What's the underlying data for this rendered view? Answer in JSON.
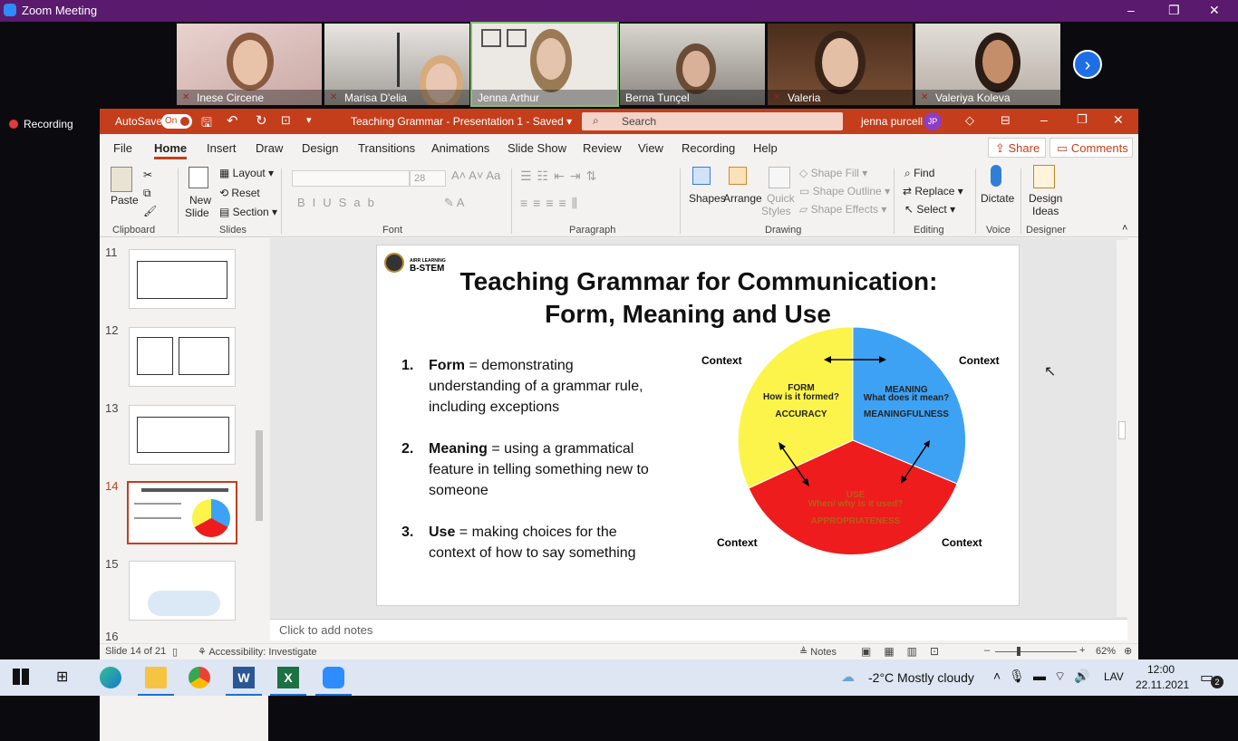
{
  "zoom": {
    "title": "Zoom Meeting",
    "recording_label": "Recording",
    "participants": [
      "Inese Circene",
      "Marisa D'elia",
      "Jenna Arthur",
      "Berna Tunçel",
      "Valeria",
      "Valeriya Koleva"
    ],
    "next_arrow": "›",
    "win_controls": {
      "minimize": "–",
      "restore": "❐",
      "close": "✕"
    }
  },
  "pp": {
    "autosave_label": "AutoSave",
    "autosave_state": "On",
    "doc_title": "Teaching Grammar - Presentation 1  -  Saved  ▾",
    "search_placeholder": "Search",
    "user": "jenna purcell",
    "user_initials": "JP",
    "tabs": [
      "File",
      "Home",
      "Insert",
      "Draw",
      "Design",
      "Transitions",
      "Animations",
      "Slide Show",
      "Review",
      "View",
      "Recording",
      "Help"
    ],
    "share": "Share",
    "comments": "Comments",
    "ribbon": {
      "paste": "Paste",
      "new_slide_1": "New",
      "new_slide_2": "Slide",
      "layout": "Layout",
      "reset": "Reset",
      "section": "Section",
      "font_size": "28",
      "shapes": "Shapes",
      "arrange": "Arrange",
      "quick_styles_1": "Quick",
      "quick_styles_2": "Styles",
      "shape_fill": "Shape Fill",
      "shape_outline": "Shape Outline",
      "shape_effects": "Shape Effects",
      "find": "Find",
      "replace": "Replace",
      "select": "Select",
      "dictate": "Dictate",
      "design_ideas_1": "Design",
      "design_ideas_2": "Ideas",
      "groups": [
        "Clipboard",
        "Slides",
        "Font",
        "Paragraph",
        "Drawing",
        "Editing",
        "Voice",
        "Designer"
      ]
    },
    "thumb_numbers": [
      "11",
      "12",
      "13",
      "14",
      "15",
      "16"
    ],
    "notes_placeholder": "Click to add notes",
    "status": {
      "slide_count": "Slide 14 of 21",
      "accessibility": "Accessibility: Investigate",
      "notes": "Notes",
      "zoom": "62%"
    }
  },
  "slide": {
    "logo_text_1": "AIRR LEARNING",
    "logo_text_2": "B-STEM",
    "title_line1": "Teaching Grammar for Communication:",
    "title_line2": "Form, Meaning and Use",
    "items": [
      {
        "num": "1.",
        "term": "Form",
        "line1": " = demonstrating",
        "line2": "understanding of a grammar rule,",
        "line3": "including exceptions"
      },
      {
        "num": "2.",
        "term": "Meaning",
        "line1": " = using a grammatical",
        "line2": "feature in telling something new to",
        "line3": "someone"
      },
      {
        "num": "3.",
        "term": "Use",
        "line1": " = making choices for the",
        "line2": "context of how to say something",
        "line3": ""
      }
    ],
    "pie": {
      "context": "Context",
      "form_title": "FORM",
      "form_q": "How is it formed?",
      "form_k": "ACCURACY",
      "meaning_title": "MEANING",
      "meaning_q": "What does it mean?",
      "meaning_k": "MEANINGFULNESS",
      "use_title": "USE",
      "use_q": "When/ why is it used?",
      "use_k": "APPROPRIATENESS",
      "colors": {
        "form": "#fcf44a",
        "meaning": "#3ea2f4",
        "use": "#ee1c1c"
      }
    }
  },
  "taskbar": {
    "weather": "-2°C  Mostly cloudy",
    "lang": "LAV",
    "time": "12:00",
    "date": "22.11.2021",
    "notif_count": "2"
  }
}
